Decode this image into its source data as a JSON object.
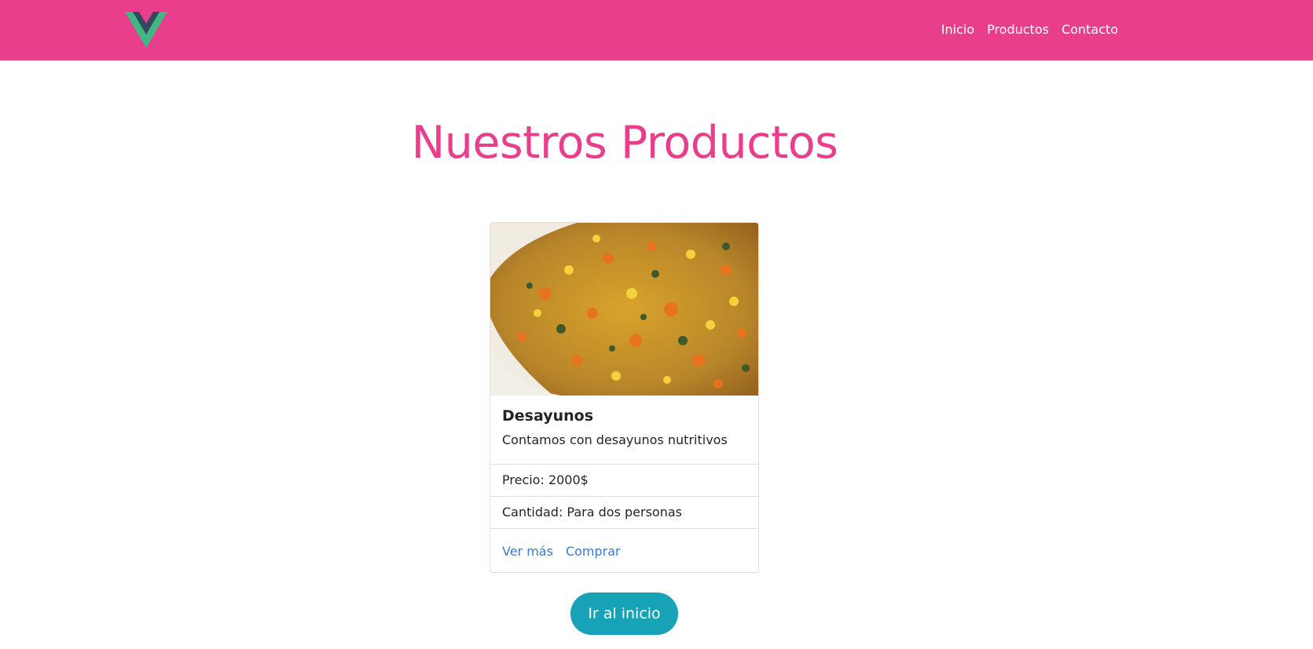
{
  "navbar": {
    "logo_icon": "vue-logo-icon",
    "background": "#e83e8c",
    "links": [
      {
        "label": "Inicio"
      },
      {
        "label": "Productos"
      },
      {
        "label": "Contacto"
      }
    ]
  },
  "main": {
    "title": "Nuestros Productos",
    "title_color": "#e83e8c"
  },
  "product": {
    "image_icon": "food-image",
    "title": "Desayunos",
    "description": "Contamos con desayunos nutritivos",
    "price": "Precio: 2000$",
    "quantity": "Cantidad: Para dos personas",
    "link_more": "Ver más",
    "link_buy": "Comprar",
    "link_color": "#3a7bd5"
  },
  "home_button": {
    "label": "Ir al inicio",
    "color": "#17a2b8"
  }
}
